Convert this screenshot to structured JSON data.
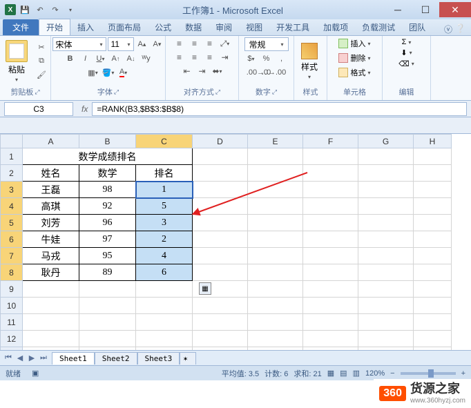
{
  "window": {
    "title": "工作簿1 - Microsoft Excel"
  },
  "tabs": {
    "file": "文件",
    "home": "开始",
    "insert": "插入",
    "layout": "页面布局",
    "formulas": "公式",
    "data": "数据",
    "review": "审阅",
    "view": "视图",
    "dev": "开发工具",
    "addins": "加载项",
    "loadtest": "负载测试",
    "team": "团队"
  },
  "ribbon": {
    "clipboard": {
      "paste": "粘贴",
      "label": "剪贴板"
    },
    "font": {
      "name": "宋体",
      "size": "11",
      "label": "字体"
    },
    "align": {
      "wrap": "自动换行",
      "merge": "合并后居中",
      "label": "对齐方式"
    },
    "number": {
      "format": "常规",
      "label": "数字"
    },
    "style": {
      "btn": "样式",
      "label": "样式"
    },
    "cells": {
      "insert": "插入",
      "delete": "删除",
      "format": "格式",
      "label": "单元格"
    },
    "editing": {
      "label": "编辑"
    }
  },
  "namebox": "C3",
  "formula": "=RANK(B3,$B$3:$B$8)",
  "chart_data": {
    "type": "table",
    "title": "数学成绩排名",
    "columns": [
      "姓名",
      "数学",
      "排名"
    ],
    "rows": [
      {
        "name": "王磊",
        "score": 98,
        "rank": 1
      },
      {
        "name": "高琪",
        "score": 92,
        "rank": 5
      },
      {
        "name": "刘芳",
        "score": 96,
        "rank": 3
      },
      {
        "name": "牛娃",
        "score": 97,
        "rank": 2
      },
      {
        "name": "马戎",
        "score": 95,
        "rank": 4
      },
      {
        "name": "耿丹",
        "score": 89,
        "rank": 6
      }
    ]
  },
  "sheets": {
    "s1": "Sheet1",
    "s2": "Sheet2",
    "s3": "Sheet3"
  },
  "status": {
    "ready": "就绪",
    "avg_label": "平均值:",
    "avg": "3.5",
    "count_label": "计数:",
    "count": "6",
    "sum_label": "求和:",
    "sum": "21",
    "zoom": "120%"
  },
  "watermark": {
    "badge": "360",
    "title": "货源之家",
    "url": "www.360hyzj.com"
  },
  "cols": [
    "A",
    "B",
    "C",
    "D",
    "E",
    "F",
    "G",
    "H"
  ]
}
